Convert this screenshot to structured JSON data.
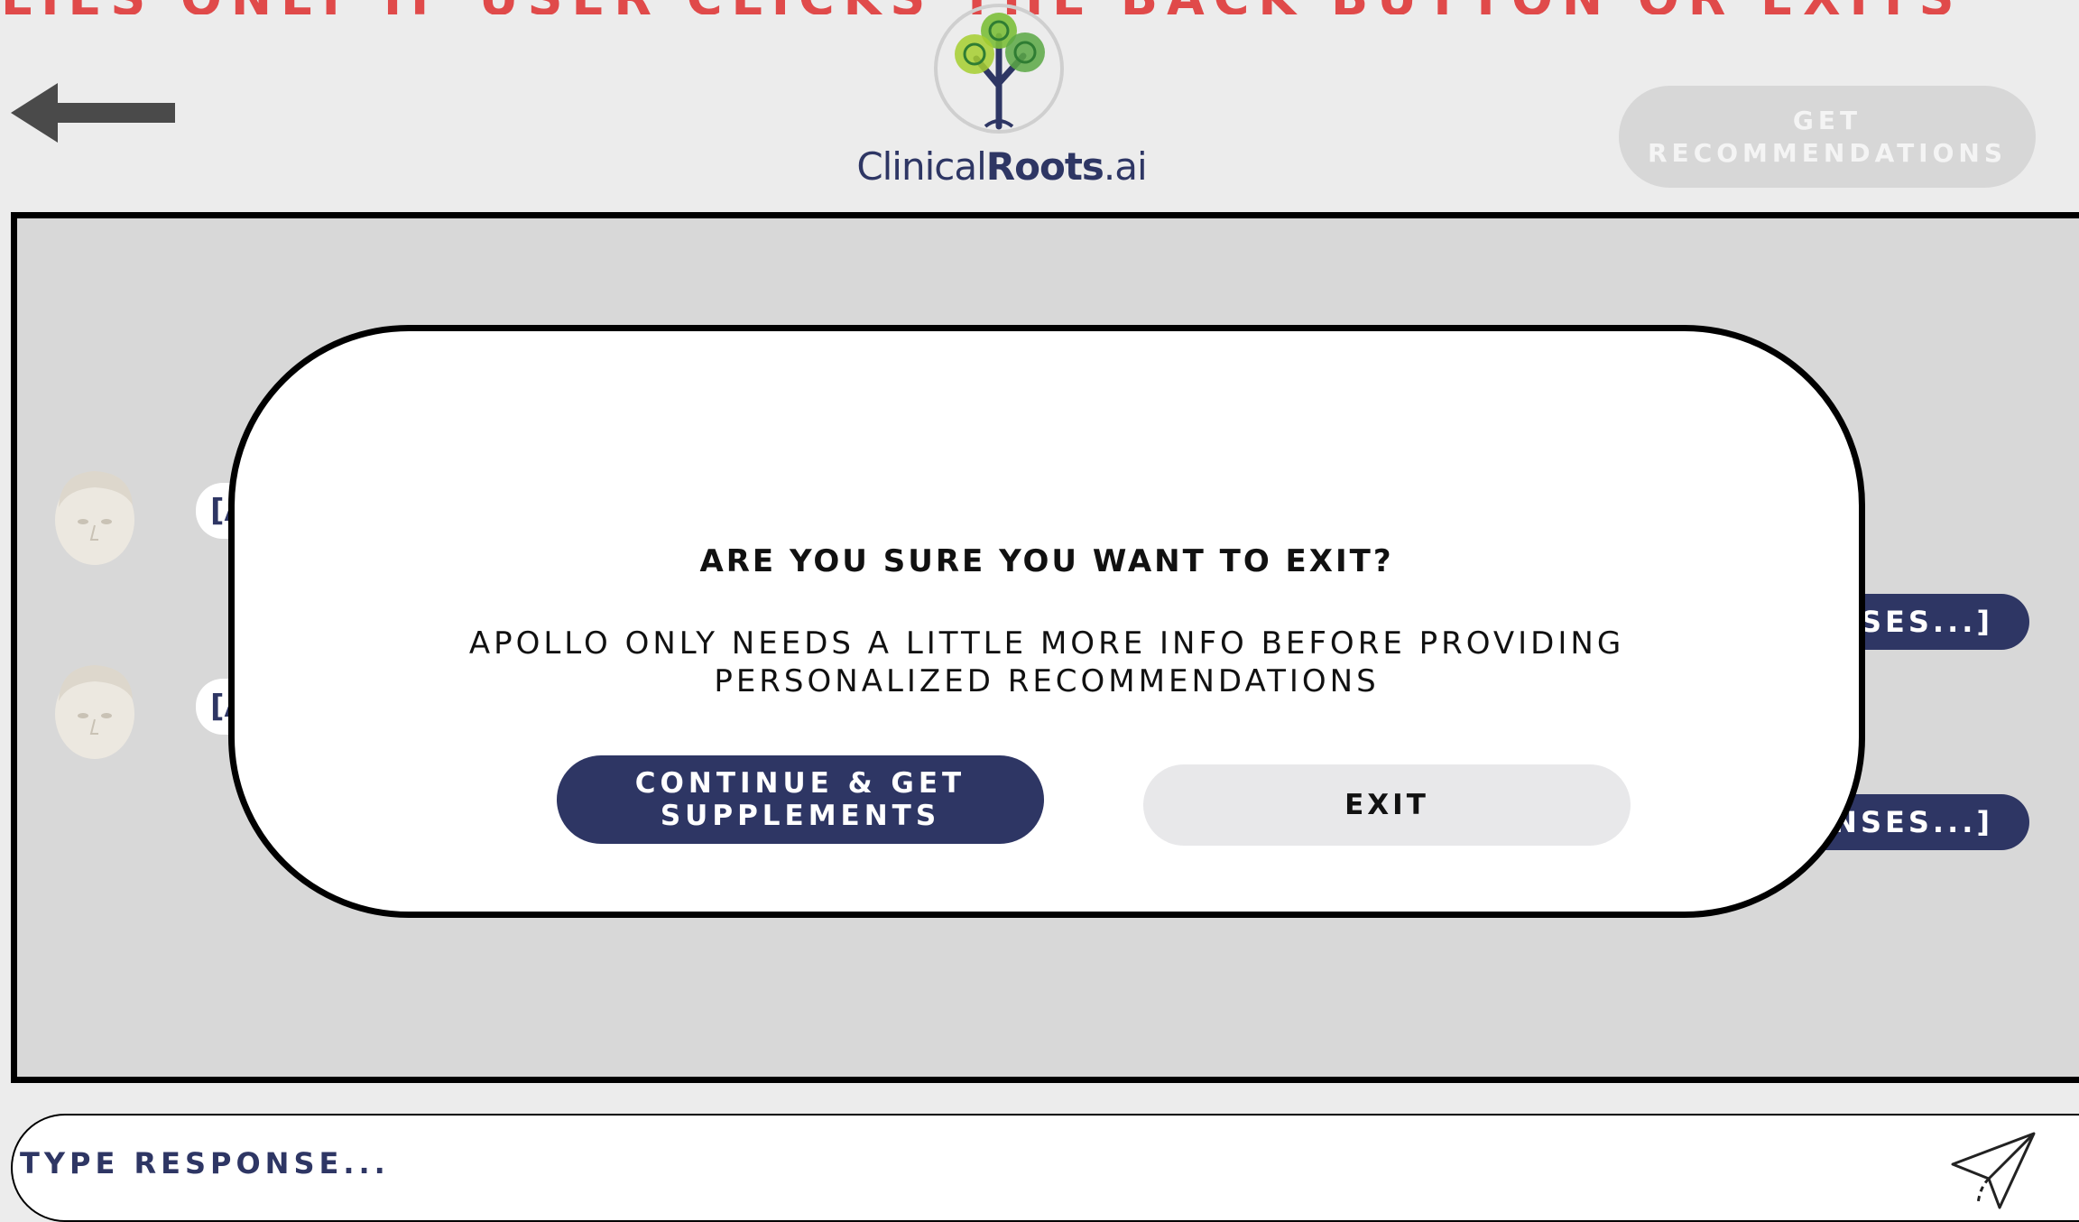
{
  "banner": {
    "text": "APPLIES ONLY IF USER CLICKS THE BACK BUTTON OR EXITS"
  },
  "header": {
    "back_icon": "arrow-left-icon",
    "logo": {
      "text_light": "Clinical",
      "text_bold": "Roots",
      "text_suffix": ".ai"
    },
    "get_recommendations_label": "GET RECOMMENDATIONS"
  },
  "chat": {
    "left_messages": [
      {
        "text": "[A"
      },
      {
        "text": "[A"
      }
    ],
    "right_messages": [
      {
        "text": "SES...]"
      },
      {
        "text": "NSES...]"
      }
    ]
  },
  "modal": {
    "title": "ARE YOU SURE YOU WANT TO EXIT?",
    "body": "APOLLO ONLY NEEDS A LITTLE MORE INFO BEFORE PROVIDING PERSONALIZED RECOMMENDATIONS",
    "continue_label": "CONTINUE & GET SUPPLEMENTS",
    "exit_label": "EXIT"
  },
  "input": {
    "placeholder": "TYPE RESPONSE...",
    "value": "",
    "send_icon": "paper-plane-icon"
  },
  "colors": {
    "brand_navy": "#2e3664",
    "banner_red": "#e04a4a",
    "panel_gray": "#d8d8d8",
    "background": "#ececec"
  }
}
